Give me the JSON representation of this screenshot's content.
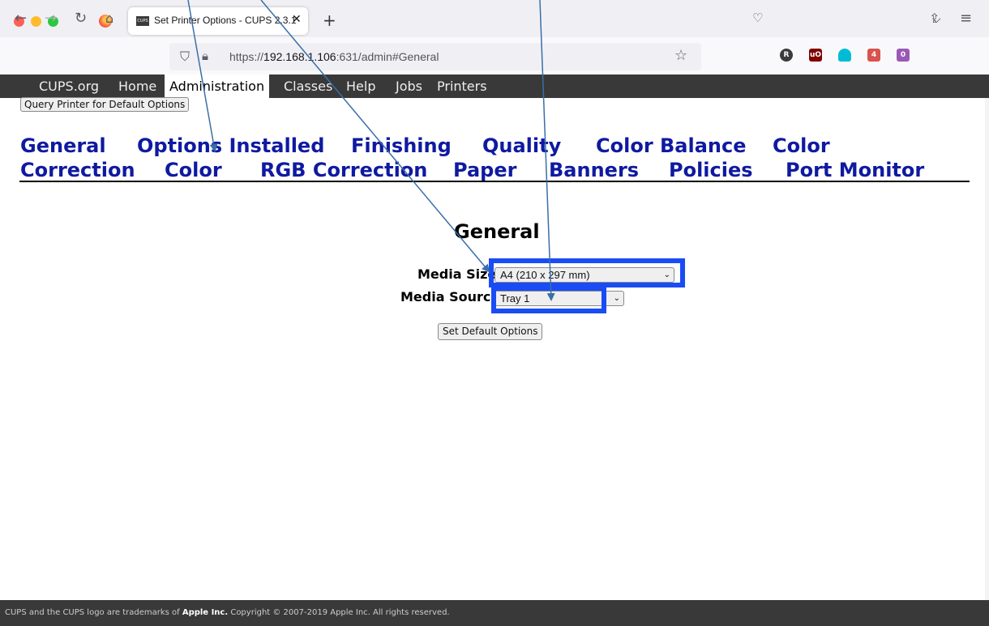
{
  "browser": {
    "tab_title": "Set Printer Options - CUPS 2.3.1",
    "tab_favicon": "CUPS",
    "url_prefix": "https://",
    "url_host": "192.168.1.106",
    "url_rest": ":631/admin#General",
    "extensions": [
      {
        "name": "R",
        "color": "#3b3b3b"
      },
      {
        "name": "uO",
        "color": "#800000"
      },
      {
        "name": "ghost",
        "color": "#00bcd4"
      },
      {
        "name": "4",
        "color": "#d9534f"
      },
      {
        "name": "0",
        "color": "#9b59b6"
      }
    ]
  },
  "cups_nav": [
    "CUPS.org",
    "Home",
    "Administration",
    "Classes",
    "Help",
    "Jobs",
    "Printers"
  ],
  "query_button": "Query Printer for Default Options",
  "option_links": {
    "general": "General",
    "options_installed": "Options Installed",
    "finishing": "Finishing",
    "quality": "Quality",
    "color_balance": "Color Balance",
    "color_a": "Color",
    "correction": "Correction",
    "color_b": "Color",
    "rgb_correction": "RGB Correction",
    "paper": "Paper",
    "banners": "Banners",
    "policies": "Policies",
    "port_monitor": "Port Monitor"
  },
  "section_title": "General",
  "fields": {
    "media_size_label": "Media Size:",
    "media_size_value": "A4 (210 x 297 mm)",
    "media_source_label": "Media Source:",
    "media_source_value": "Tray 1"
  },
  "set_default_button": "Set Default Options",
  "footer": {
    "pre": "CUPS and the CUPS logo are trademarks of ",
    "apple": "Apple Inc.",
    "post": " Copyright © 2007-2019 Apple Inc. All rights reserved."
  },
  "colors": {
    "link": "#0f1aa0",
    "header_bg": "#393939",
    "highlight": "#1a4cf5"
  }
}
